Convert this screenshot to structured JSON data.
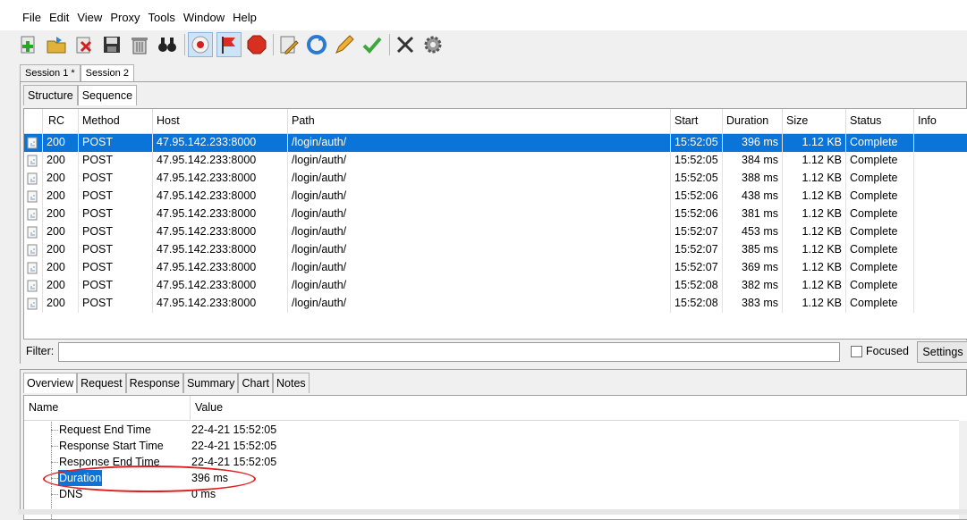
{
  "menu": {
    "items": [
      "File",
      "Edit",
      "View",
      "Proxy",
      "Tools",
      "Window",
      "Help"
    ]
  },
  "toolbar": {
    "icons": [
      "new-session-icon",
      "open-icon",
      "close-session-icon",
      "save-icon",
      "trash-icon",
      "binoculars-find-icon",
      "record-icon",
      "flag-breakpoint-icon",
      "stop-icon",
      "edit-icon",
      "repeat-icon",
      "pencil-icon",
      "validate-check-icon",
      "tools-icon",
      "settings-gear-icon"
    ]
  },
  "sessions": [
    "Session 1 *",
    "Session 2"
  ],
  "view_tabs": [
    "Structure",
    "Sequence"
  ],
  "table": {
    "columns": [
      "RC",
      "Method",
      "Host",
      "Path",
      "Start",
      "Duration",
      "Size",
      "Status",
      "Info"
    ],
    "rows": [
      {
        "rc": "200",
        "method": "POST",
        "host": "47.95.142.233:8000",
        "path": "/login/auth/",
        "start": "15:52:05",
        "duration": "396 ms",
        "size": "1.12 KB",
        "status": "Complete",
        "info": ""
      },
      {
        "rc": "200",
        "method": "POST",
        "host": "47.95.142.233:8000",
        "path": "/login/auth/",
        "start": "15:52:05",
        "duration": "384 ms",
        "size": "1.12 KB",
        "status": "Complete",
        "info": ""
      },
      {
        "rc": "200",
        "method": "POST",
        "host": "47.95.142.233:8000",
        "path": "/login/auth/",
        "start": "15:52:05",
        "duration": "388 ms",
        "size": "1.12 KB",
        "status": "Complete",
        "info": ""
      },
      {
        "rc": "200",
        "method": "POST",
        "host": "47.95.142.233:8000",
        "path": "/login/auth/",
        "start": "15:52:06",
        "duration": "438 ms",
        "size": "1.12 KB",
        "status": "Complete",
        "info": ""
      },
      {
        "rc": "200",
        "method": "POST",
        "host": "47.95.142.233:8000",
        "path": "/login/auth/",
        "start": "15:52:06",
        "duration": "381 ms",
        "size": "1.12 KB",
        "status": "Complete",
        "info": ""
      },
      {
        "rc": "200",
        "method": "POST",
        "host": "47.95.142.233:8000",
        "path": "/login/auth/",
        "start": "15:52:07",
        "duration": "453 ms",
        "size": "1.12 KB",
        "status": "Complete",
        "info": ""
      },
      {
        "rc": "200",
        "method": "POST",
        "host": "47.95.142.233:8000",
        "path": "/login/auth/",
        "start": "15:52:07",
        "duration": "385 ms",
        "size": "1.12 KB",
        "status": "Complete",
        "info": ""
      },
      {
        "rc": "200",
        "method": "POST",
        "host": "47.95.142.233:8000",
        "path": "/login/auth/",
        "start": "15:52:07",
        "duration": "369 ms",
        "size": "1.12 KB",
        "status": "Complete",
        "info": ""
      },
      {
        "rc": "200",
        "method": "POST",
        "host": "47.95.142.233:8000",
        "path": "/login/auth/",
        "start": "15:52:08",
        "duration": "382 ms",
        "size": "1.12 KB",
        "status": "Complete",
        "info": ""
      },
      {
        "rc": "200",
        "method": "POST",
        "host": "47.95.142.233:8000",
        "path": "/login/auth/",
        "start": "15:52:08",
        "duration": "383 ms",
        "size": "1.12 KB",
        "status": "Complete",
        "info": ""
      }
    ]
  },
  "filter": {
    "label": "Filter:",
    "value": "",
    "focused_label": "Focused",
    "settings_label": "Settings"
  },
  "detail_tabs": [
    "Overview",
    "Request",
    "Response",
    "Summary",
    "Chart",
    "Notes"
  ],
  "detail": {
    "columns": [
      "Name",
      "Value"
    ],
    "rows": [
      {
        "name": "Request End Time",
        "value": "22-4-21 15:52:05"
      },
      {
        "name": "Response Start Time",
        "value": "22-4-21 15:52:05"
      },
      {
        "name": "Response End Time",
        "value": "22-4-21 15:52:05"
      },
      {
        "name": "Duration",
        "value": "396 ms"
      },
      {
        "name": "DNS",
        "value": "0 ms"
      }
    ]
  },
  "colors": {
    "selection": "#0a74d9",
    "annotation": "#e02020"
  }
}
